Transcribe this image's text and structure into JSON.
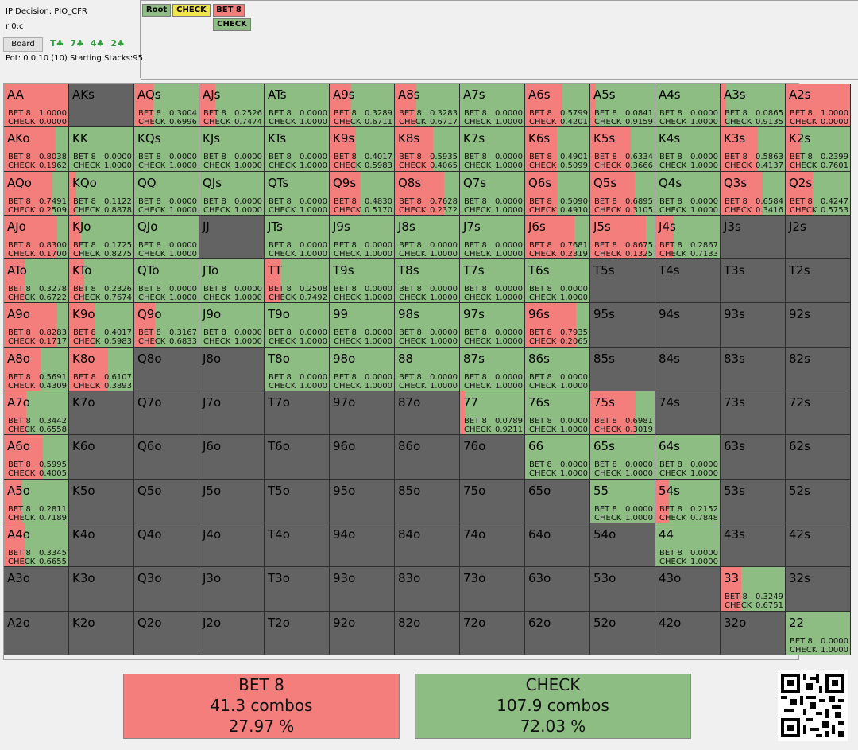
{
  "info": {
    "decision": "IP Decision:  PIO_CFR",
    "node_path": "r:0:c",
    "board_button": "Board",
    "board_cards": [
      "T♣",
      "7♣",
      "4♣",
      "2♣"
    ],
    "pot_line": "Pot: 0 0 10 (10) Starting Stacks:95"
  },
  "tree": {
    "root": "Root",
    "check": "CHECK",
    "bet": "BET 8",
    "check_child": "CHECK"
  },
  "action_labels": {
    "bet": "BET 8",
    "check": "CHECK"
  },
  "colors": {
    "bet": "#f47e7c",
    "check": "#8ebd84",
    "empty_cell": "#636363",
    "root_node": "#8ebd84",
    "check_node": "#f3e44a",
    "bet_node": "#f47e7c"
  },
  "hands": [
    [
      "AA",
      "AKs",
      "AQs",
      "AJs",
      "ATs",
      "A9s",
      "A8s",
      "A7s",
      "A6s",
      "A5s",
      "A4s",
      "A3s",
      "A2s"
    ],
    [
      "AKo",
      "KK",
      "KQs",
      "KJs",
      "KTs",
      "K9s",
      "K8s",
      "K7s",
      "K6s",
      "K5s",
      "K4s",
      "K3s",
      "K2s"
    ],
    [
      "AQo",
      "KQo",
      "QQ",
      "QJs",
      "QTs",
      "Q9s",
      "Q8s",
      "Q7s",
      "Q6s",
      "Q5s",
      "Q4s",
      "Q3s",
      "Q2s"
    ],
    [
      "AJo",
      "KJo",
      "QJo",
      "JJ",
      "JTs",
      "J9s",
      "J8s",
      "J7s",
      "J6s",
      "J5s",
      "J4s",
      "J3s",
      "J2s"
    ],
    [
      "ATo",
      "KTo",
      "QTo",
      "JTo",
      "TT",
      "T9s",
      "T8s",
      "T7s",
      "T6s",
      "T5s",
      "T4s",
      "T3s",
      "T2s"
    ],
    [
      "A9o",
      "K9o",
      "Q9o",
      "J9o",
      "T9o",
      "99",
      "98s",
      "97s",
      "96s",
      "95s",
      "94s",
      "93s",
      "92s"
    ],
    [
      "A8o",
      "K8o",
      "Q8o",
      "J8o",
      "T8o",
      "98o",
      "88",
      "87s",
      "86s",
      "85s",
      "84s",
      "83s",
      "82s"
    ],
    [
      "A7o",
      "K7o",
      "Q7o",
      "J7o",
      "T7o",
      "97o",
      "87o",
      "77",
      "76s",
      "75s",
      "74s",
      "73s",
      "72s"
    ],
    [
      "A6o",
      "K6o",
      "Q6o",
      "J6o",
      "T6o",
      "96o",
      "86o",
      "76o",
      "66",
      "65s",
      "64s",
      "63s",
      "62s"
    ],
    [
      "A5o",
      "K5o",
      "Q5o",
      "J5o",
      "T5o",
      "95o",
      "85o",
      "75o",
      "65o",
      "55",
      "54s",
      "53s",
      "52s"
    ],
    [
      "A4o",
      "K4o",
      "Q4o",
      "J4o",
      "T4o",
      "94o",
      "84o",
      "74o",
      "64o",
      "54o",
      "44",
      "43s",
      "42s"
    ],
    [
      "A3o",
      "K3o",
      "Q3o",
      "J3o",
      "T3o",
      "93o",
      "83o",
      "73o",
      "63o",
      "53o",
      "43o",
      "33",
      "32s"
    ],
    [
      "A2o",
      "K2o",
      "Q2o",
      "J2o",
      "T2o",
      "92o",
      "82o",
      "72o",
      "62o",
      "52o",
      "42o",
      "32o",
      "22"
    ]
  ],
  "frequencies": {
    "AA": [
      "1.0000",
      "0.0000"
    ],
    "AQs": [
      "0.3004",
      "0.6996"
    ],
    "AJs": [
      "0.2526",
      "0.7474"
    ],
    "ATs": [
      "0.0000",
      "1.0000"
    ],
    "A9s": [
      "0.3289",
      "0.6711"
    ],
    "A8s": [
      "0.3283",
      "0.6717"
    ],
    "A7s": [
      "0.0000",
      "1.0000"
    ],
    "A6s": [
      "0.5799",
      "0.4201"
    ],
    "A5s": [
      "0.0841",
      "0.9159"
    ],
    "A4s": [
      "0.0000",
      "1.0000"
    ],
    "A3s": [
      "0.0865",
      "0.9135"
    ],
    "A2s": [
      "1.0000",
      "0.0000"
    ],
    "AKo": [
      "0.8038",
      "0.1962"
    ],
    "KK": [
      "0.0000",
      "1.0000"
    ],
    "KQs": [
      "0.0000",
      "1.0000"
    ],
    "KJs": [
      "0.0000",
      "1.0000"
    ],
    "KTs": [
      "0.0000",
      "1.0000"
    ],
    "K9s": [
      "0.4017",
      "0.5983"
    ],
    "K8s": [
      "0.5935",
      "0.4065"
    ],
    "K7s": [
      "0.0000",
      "1.0000"
    ],
    "K6s": [
      "0.4901",
      "0.5099"
    ],
    "K5s": [
      "0.6334",
      "0.3666"
    ],
    "K4s": [
      "0.0000",
      "1.0000"
    ],
    "K3s": [
      "0.5863",
      "0.4137"
    ],
    "K2s": [
      "0.2399",
      "0.7601"
    ],
    "AQo": [
      "0.7491",
      "0.2509"
    ],
    "KQo": [
      "0.1122",
      "0.8878"
    ],
    "QQ": [
      "0.0000",
      "1.0000"
    ],
    "QJs": [
      "0.0000",
      "1.0000"
    ],
    "QTs": [
      "0.0000",
      "1.0000"
    ],
    "Q9s": [
      "0.4830",
      "0.5170"
    ],
    "Q8s": [
      "0.7628",
      "0.2372"
    ],
    "Q7s": [
      "0.0000",
      "1.0000"
    ],
    "Q6s": [
      "0.5090",
      "0.4910"
    ],
    "Q5s": [
      "0.6895",
      "0.3105"
    ],
    "Q4s": [
      "0.0000",
      "1.0000"
    ],
    "Q3s": [
      "0.6584",
      "0.3416"
    ],
    "Q2s": [
      "0.4247",
      "0.5753"
    ],
    "AJo": [
      "0.8300",
      "0.1700"
    ],
    "KJo": [
      "0.1725",
      "0.8275"
    ],
    "QJo": [
      "0.0000",
      "1.0000"
    ],
    "JTs": [
      "0.0000",
      "1.0000"
    ],
    "J9s": [
      "0.0000",
      "1.0000"
    ],
    "J8s": [
      "0.0000",
      "1.0000"
    ],
    "J7s": [
      "0.0000",
      "1.0000"
    ],
    "J6s": [
      "0.7681",
      "0.2319"
    ],
    "J5s": [
      "0.8675",
      "0.1325"
    ],
    "J4s": [
      "0.2867",
      "0.7133"
    ],
    "ATo": [
      "0.3278",
      "0.6722"
    ],
    "KTo": [
      "0.2326",
      "0.7674"
    ],
    "QTo": [
      "0.0000",
      "1.0000"
    ],
    "JTo": [
      "0.0000",
      "1.0000"
    ],
    "TT": [
      "0.2508",
      "0.7492"
    ],
    "T9s": [
      "0.0000",
      "1.0000"
    ],
    "T8s": [
      "0.0000",
      "1.0000"
    ],
    "T7s": [
      "0.0000",
      "1.0000"
    ],
    "T6s": [
      "0.0000",
      "1.0000"
    ],
    "A9o": [
      "0.8283",
      "0.1717"
    ],
    "K9o": [
      "0.4017",
      "0.5983"
    ],
    "Q9o": [
      "0.3167",
      "0.6833"
    ],
    "J9o": [
      "0.0000",
      "1.0000"
    ],
    "T9o": [
      "0.0000",
      "1.0000"
    ],
    "99": [
      "0.0000",
      "1.0000"
    ],
    "98s": [
      "0.0000",
      "1.0000"
    ],
    "97s": [
      "0.0000",
      "1.0000"
    ],
    "96s": [
      "0.7935",
      "0.2065"
    ],
    "A8o": [
      "0.5691",
      "0.4309"
    ],
    "K8o": [
      "0.6107",
      "0.3893"
    ],
    "T8o": [
      "0.0000",
      "1.0000"
    ],
    "98o": [
      "0.0000",
      "1.0000"
    ],
    "88": [
      "0.0000",
      "1.0000"
    ],
    "87s": [
      "0.0000",
      "1.0000"
    ],
    "86s": [
      "0.0000",
      "1.0000"
    ],
    "A7o": [
      "0.3442",
      "0.6558"
    ],
    "77": [
      "0.0789",
      "0.9211"
    ],
    "76s": [
      "0.0000",
      "1.0000"
    ],
    "75s": [
      "0.6981",
      "0.3019"
    ],
    "A6o": [
      "0.5995",
      "0.4005"
    ],
    "66": [
      "0.0000",
      "1.0000"
    ],
    "65s": [
      "0.0000",
      "1.0000"
    ],
    "64s": [
      "0.0000",
      "1.0000"
    ],
    "A5o": [
      "0.2811",
      "0.7189"
    ],
    "55": [
      "0.0000",
      "1.0000"
    ],
    "54s": [
      "0.2152",
      "0.7848"
    ],
    "A4o": [
      "0.3345",
      "0.6655"
    ],
    "44": [
      "0.0000",
      "1.0000"
    ],
    "33": [
      "0.3249",
      "0.6751"
    ],
    "22": [
      "0.0000",
      "1.0000"
    ]
  },
  "frequency_notes": {
    "AA": {
      "bar": "full"
    },
    "KK": {
      "bar": "partial"
    },
    "QQ": {
      "bar": "partial"
    },
    "JJ": {
      "bar": "none"
    },
    "TT": {
      "bar": "full"
    },
    "99": {
      "bar": "partial"
    },
    "88": {
      "bar": "partial"
    },
    "77": {
      "bar": "full"
    },
    "66": {
      "bar": "partial"
    },
    "55": {
      "bar": "partial"
    },
    "44": {
      "bar": "full"
    },
    "33": {
      "bar": "partial"
    },
    "22": {
      "bar": "partial"
    }
  },
  "summary": {
    "bet": {
      "label": "BET 8",
      "combos": "41.3 combos",
      "percent": "27.97 %"
    },
    "check": {
      "label": "CHECK",
      "combos": "107.9 combos",
      "percent": "72.03 %"
    }
  }
}
